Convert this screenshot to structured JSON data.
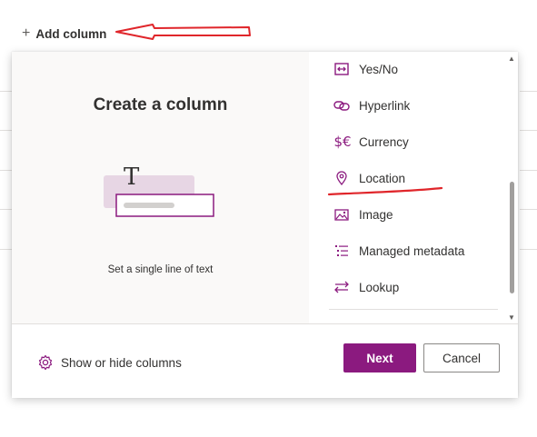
{
  "page": {
    "add_column_label": "Add column"
  },
  "panel": {
    "title": "Create a column",
    "description": "Set a single line of text",
    "preview_glyph": "T",
    "column_types": [
      {
        "label": "Yes/No",
        "icon": "yes-no-icon"
      },
      {
        "label": "Hyperlink",
        "icon": "hyperlink-icon"
      },
      {
        "label": "Currency",
        "icon": "currency-icon",
        "glyph": "$€"
      },
      {
        "label": "Location",
        "icon": "location-icon"
      },
      {
        "label": "Image",
        "icon": "image-icon"
      },
      {
        "label": "Managed metadata",
        "icon": "managed-metadata-icon"
      },
      {
        "label": "Lookup",
        "icon": "lookup-icon"
      }
    ],
    "footer": {
      "show_hide_label": "Show or hide columns",
      "next_label": "Next",
      "cancel_label": "Cancel"
    }
  },
  "colors": {
    "accent": "#8b1a7f",
    "annotation": "#e0262b"
  }
}
